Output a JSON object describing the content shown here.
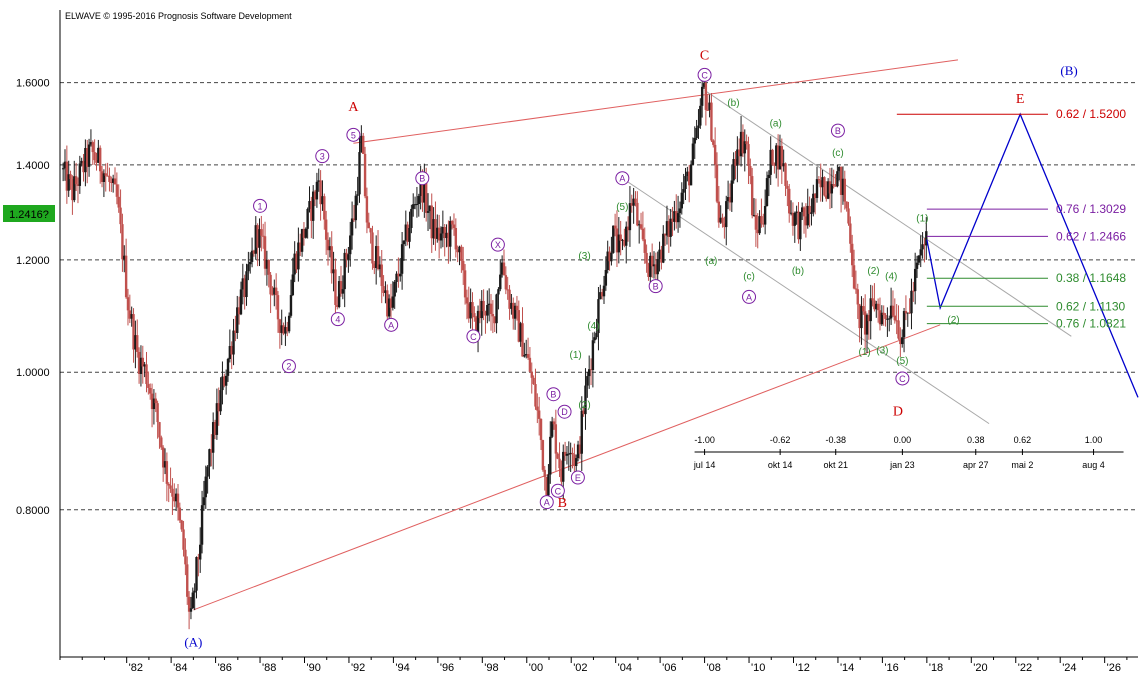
{
  "header": {
    "copyright": "ELWAVE © 1995-2016 Prognosis Software Development"
  },
  "current_price_label": "1.2416?",
  "colors": {
    "candle_up": "#1a1a1a",
    "candle_down": "#c0504d",
    "channel_red": "#e06060",
    "channel_gray": "#a8a8a8",
    "projection_blue": "#0000cc",
    "purple": "#7b1fa2",
    "green": "#2e8b2e",
    "red_label": "#cc0000",
    "blue_label": "#0000cc",
    "badge_green": "#1fa81f"
  },
  "chart_data": {
    "type": "candlestick",
    "x_axis": {
      "range": [
        1979.0,
        2027.5
      ],
      "tick_years": [
        1982,
        1984,
        1986,
        1988,
        1990,
        1992,
        1994,
        1996,
        1998,
        2000,
        2002,
        2004,
        2006,
        2008,
        2010,
        2012,
        2014,
        2016,
        2018,
        2020,
        2022,
        2024,
        2026
      ],
      "tick_labels": [
        "'82",
        "'84",
        "'86",
        "'88",
        "'90",
        "'92",
        "'94",
        "'96",
        "'98",
        "'00",
        "'02",
        "'04",
        "'06",
        "'08",
        "'10",
        "'12",
        "'14",
        "'16",
        "'18",
        "'20",
        "'22",
        "'24",
        "'26"
      ]
    },
    "y_axis": {
      "scale": "log",
      "range": [
        0.63,
        1.8
      ],
      "ticks": [
        0.8,
        1.0,
        1.2,
        1.4,
        1.6
      ],
      "tick_labels": [
        "0.8000",
        "1.0000",
        "1.2000",
        "1.4000",
        "1.6000"
      ],
      "grid": "dashed"
    },
    "price_path": [
      [
        1979.1,
        1.39
      ],
      [
        1979.6,
        1.34
      ],
      [
        1980.4,
        1.43
      ],
      [
        1980.9,
        1.4
      ],
      [
        1981.6,
        1.32
      ],
      [
        1982.1,
        1.12
      ],
      [
        1982.5,
        1.03
      ],
      [
        1982.9,
        1.0
      ],
      [
        1983.4,
        0.93
      ],
      [
        1983.8,
        0.85
      ],
      [
        1984.2,
        0.82
      ],
      [
        1984.6,
        0.75
      ],
      [
        1984.9,
        0.66
      ],
      [
        1985.3,
        0.75
      ],
      [
        1985.7,
        0.86
      ],
      [
        1986.2,
        0.95
      ],
      [
        1986.7,
        1.04
      ],
      [
        1987.1,
        1.12
      ],
      [
        1987.5,
        1.16
      ],
      [
        1987.9,
        1.26
      ],
      [
        1988.3,
        1.2
      ],
      [
        1988.8,
        1.1
      ],
      [
        1989.2,
        1.07
      ],
      [
        1989.6,
        1.2
      ],
      [
        1990.2,
        1.28
      ],
      [
        1990.7,
        1.37
      ],
      [
        1991.1,
        1.22
      ],
      [
        1991.5,
        1.12
      ],
      [
        1991.9,
        1.2
      ],
      [
        1992.3,
        1.3
      ],
      [
        1992.6,
        1.45
      ],
      [
        1992.9,
        1.25
      ],
      [
        1993.4,
        1.18
      ],
      [
        1993.9,
        1.1
      ],
      [
        1994.4,
        1.2
      ],
      [
        1994.9,
        1.3
      ],
      [
        1995.3,
        1.36
      ],
      [
        1995.8,
        1.26
      ],
      [
        1996.3,
        1.24
      ],
      [
        1996.8,
        1.26
      ],
      [
        1997.2,
        1.15
      ],
      [
        1997.7,
        1.07
      ],
      [
        1998.1,
        1.12
      ],
      [
        1998.5,
        1.08
      ],
      [
        1998.9,
        1.2
      ],
      [
        1999.3,
        1.12
      ],
      [
        1999.7,
        1.07
      ],
      [
        2000.2,
        1.0
      ],
      [
        2000.6,
        0.92
      ],
      [
        2000.9,
        0.83
      ],
      [
        2001.2,
        0.92
      ],
      [
        2001.6,
        0.85
      ],
      [
        2001.9,
        0.9
      ],
      [
        2002.3,
        0.86
      ],
      [
        2002.7,
        0.97
      ],
      [
        2003.1,
        1.07
      ],
      [
        2003.5,
        1.17
      ],
      [
        2003.9,
        1.25
      ],
      [
        2004.3,
        1.21
      ],
      [
        2004.8,
        1.33
      ],
      [
        2005.2,
        1.23
      ],
      [
        2005.6,
        1.18
      ],
      [
        2006.0,
        1.21
      ],
      [
        2006.5,
        1.27
      ],
      [
        2006.9,
        1.32
      ],
      [
        2007.3,
        1.37
      ],
      [
        2007.7,
        1.46
      ],
      [
        2008.0,
        1.59
      ],
      [
        2008.4,
        1.48
      ],
      [
        2008.7,
        1.26
      ],
      [
        2009.1,
        1.3
      ],
      [
        2009.5,
        1.45
      ],
      [
        2009.9,
        1.46
      ],
      [
        2010.3,
        1.25
      ],
      [
        2010.7,
        1.3
      ],
      [
        2011.1,
        1.43
      ],
      [
        2011.5,
        1.42
      ],
      [
        2011.9,
        1.3
      ],
      [
        2012.3,
        1.27
      ],
      [
        2012.7,
        1.29
      ],
      [
        2013.1,
        1.34
      ],
      [
        2013.6,
        1.36
      ],
      [
        2013.9,
        1.39
      ],
      [
        2014.3,
        1.34
      ],
      [
        2014.6,
        1.25
      ],
      [
        2014.9,
        1.1
      ],
      [
        2015.3,
        1.08
      ],
      [
        2015.7,
        1.12
      ],
      [
        2016.1,
        1.09
      ],
      [
        2016.5,
        1.12
      ],
      [
        2016.9,
        1.06
      ],
      [
        2017.3,
        1.12
      ],
      [
        2017.7,
        1.2
      ],
      [
        2018.0,
        1.24
      ]
    ],
    "projection_path": [
      [
        2018.0,
        1.24
      ],
      [
        2018.6,
        1.11
      ],
      [
        2022.2,
        1.52
      ],
      [
        2027.5,
        0.96
      ]
    ],
    "channel_lines": [
      {
        "color": "red",
        "points": [
          [
            1985.0,
            0.68
          ],
          [
            2018.6,
            1.08
          ]
        ]
      },
      {
        "color": "red",
        "points": [
          [
            1992.2,
            1.45
          ],
          [
            2019.4,
            1.66
          ]
        ]
      },
      {
        "color": "gray",
        "points": [
          [
            2008.0,
            1.58
          ],
          [
            2024.5,
            1.06
          ]
        ]
      },
      {
        "color": "gray",
        "points": [
          [
            2004.3,
            1.37
          ],
          [
            2020.8,
            0.92
          ]
        ]
      }
    ],
    "fib_levels": [
      {
        "label": "0.62 / 1.5200",
        "ratio": 0.62,
        "value": 1.52,
        "color": "#cc0000"
      },
      {
        "label": "0.76 / 1.3029",
        "ratio": 0.76,
        "value": 1.3029,
        "color": "#7b1fa2"
      },
      {
        "label": "0.62 / 1.2466",
        "ratio": 0.62,
        "value": 1.2466,
        "color": "#7b1fa2"
      },
      {
        "label": "0.38 / 1.1648",
        "ratio": 0.38,
        "value": 1.1648,
        "color": "#2e8b2e"
      },
      {
        "label": "0.62 / 1.1130",
        "ratio": 0.62,
        "value": 1.113,
        "color": "#2e8b2e"
      },
      {
        "label": "0.76 / 1.0821",
        "ratio": 0.76,
        "value": 1.0821,
        "color": "#2e8b2e"
      }
    ],
    "time_ruler": {
      "ratios": [
        "-1.00",
        "-0.62",
        "-0.38",
        "0.00",
        "0.38",
        "0.62",
        "1.00"
      ],
      "dates": [
        {
          "label": "jul 14",
          "year": 2008.0
        },
        {
          "label": "okt 14",
          "year": 2011.4
        },
        {
          "label": "okt 21",
          "year": 2013.9
        },
        {
          "label": "jan 23",
          "year": 2016.9
        },
        {
          "label": "apr 27",
          "year": 2020.2
        },
        {
          "label": "mai 2",
          "year": 2022.3
        },
        {
          "label": "aug 4",
          "year": 2025.5
        }
      ],
      "ratio_years": [
        2008.0,
        2011.4,
        2013.9,
        2016.9,
        2020.2,
        2022.3,
        2025.5
      ]
    },
    "wave_labels": [
      {
        "text": "(A)",
        "x": 1985.0,
        "y": 0.645,
        "color": "blue",
        "style": "paren"
      },
      {
        "text": "A",
        "x": 1992.2,
        "y": 1.54,
        "color": "red",
        "style": "plain"
      },
      {
        "text": "B",
        "x": 2001.6,
        "y": 0.81,
        "color": "red",
        "style": "plain"
      },
      {
        "text": "C",
        "x": 2008.0,
        "y": 1.675,
        "color": "red",
        "style": "plain"
      },
      {
        "text": "D",
        "x": 2016.7,
        "y": 0.94,
        "color": "red",
        "style": "plain"
      },
      {
        "text": "E",
        "x": 2022.2,
        "y": 1.56,
        "color": "red",
        "style": "plain"
      },
      {
        "text": "(B)",
        "x": 2024.4,
        "y": 1.63,
        "color": "blue",
        "style": "paren"
      },
      {
        "text": "1",
        "x": 1988.0,
        "y": 1.31,
        "color": "purple",
        "style": "circle"
      },
      {
        "text": "2",
        "x": 1989.3,
        "y": 1.01,
        "color": "purple",
        "style": "circle"
      },
      {
        "text": "3",
        "x": 1990.8,
        "y": 1.42,
        "color": "purple",
        "style": "circle"
      },
      {
        "text": "4",
        "x": 1991.5,
        "y": 1.09,
        "color": "purple",
        "style": "circle"
      },
      {
        "text": "5",
        "x": 1992.2,
        "y": 1.47,
        "color": "purple",
        "style": "circle"
      },
      {
        "text": "A",
        "x": 1993.9,
        "y": 1.08,
        "color": "purple",
        "style": "circle"
      },
      {
        "text": "B",
        "x": 1995.3,
        "y": 1.37,
        "color": "purple",
        "style": "circle"
      },
      {
        "text": "C",
        "x": 1997.6,
        "y": 1.06,
        "color": "purple",
        "style": "circle"
      },
      {
        "text": "X",
        "x": 1998.7,
        "y": 1.23,
        "color": "purple",
        "style": "circle"
      },
      {
        "text": "A",
        "x": 2000.9,
        "y": 0.81,
        "color": "purple",
        "style": "circle"
      },
      {
        "text": "B",
        "x": 2001.2,
        "y": 0.965,
        "color": "purple",
        "style": "circle"
      },
      {
        "text": "C",
        "x": 2001.4,
        "y": 0.825,
        "color": "purple",
        "style": "circle"
      },
      {
        "text": "D",
        "x": 2001.7,
        "y": 0.938,
        "color": "purple",
        "style": "circle"
      },
      {
        "text": "E",
        "x": 2002.3,
        "y": 0.843,
        "color": "purple",
        "style": "circle"
      },
      {
        "text": "A",
        "x": 2004.3,
        "y": 1.37,
        "color": "purple",
        "style": "circle"
      },
      {
        "text": "B",
        "x": 2005.8,
        "y": 1.15,
        "color": "purple",
        "style": "circle"
      },
      {
        "text": "C",
        "x": 2008.0,
        "y": 1.62,
        "color": "purple",
        "style": "circle"
      },
      {
        "text": "A",
        "x": 2010.0,
        "y": 1.13,
        "color": "purple",
        "style": "circle"
      },
      {
        "text": "B",
        "x": 2014.0,
        "y": 1.48,
        "color": "purple",
        "style": "circle"
      },
      {
        "text": "C",
        "x": 2016.9,
        "y": 0.99,
        "color": "purple",
        "style": "circle"
      },
      {
        "text": "3",
        "x": 2002.6,
        "y": 1.21,
        "color": "green",
        "style": "paren"
      },
      {
        "text": "4",
        "x": 2003.0,
        "y": 1.08,
        "color": "green",
        "style": "paren"
      },
      {
        "text": "5",
        "x": 2004.3,
        "y": 1.31,
        "color": "green",
        "style": "paren"
      },
      {
        "text": "1",
        "x": 2002.2,
        "y": 1.03,
        "color": "green",
        "style": "paren"
      },
      {
        "text": "2",
        "x": 2002.6,
        "y": 0.95,
        "color": "green",
        "style": "paren"
      },
      {
        "text": "a",
        "x": 2008.3,
        "y": 1.2,
        "color": "green",
        "style": "paren"
      },
      {
        "text": "b",
        "x": 2009.3,
        "y": 1.55,
        "color": "green",
        "style": "paren"
      },
      {
        "text": "c",
        "x": 2010.0,
        "y": 1.17,
        "color": "green",
        "style": "paren"
      },
      {
        "text": "a",
        "x": 2011.2,
        "y": 1.5,
        "color": "green",
        "style": "paren"
      },
      {
        "text": "b",
        "x": 2012.2,
        "y": 1.18,
        "color": "green",
        "style": "paren"
      },
      {
        "text": "c",
        "x": 2014.0,
        "y": 1.43,
        "color": "green",
        "style": "paren"
      },
      {
        "text": "1",
        "x": 2015.2,
        "y": 1.035,
        "color": "green",
        "style": "paren"
      },
      {
        "text": "2",
        "x": 2015.6,
        "y": 1.18,
        "color": "green",
        "style": "paren"
      },
      {
        "text": "3",
        "x": 2016.0,
        "y": 1.038,
        "color": "green",
        "style": "paren"
      },
      {
        "text": "4",
        "x": 2016.4,
        "y": 1.17,
        "color": "green",
        "style": "paren"
      },
      {
        "text": "5",
        "x": 2016.9,
        "y": 1.02,
        "color": "green",
        "style": "paren"
      },
      {
        "text": "1",
        "x": 2017.8,
        "y": 1.285,
        "color": "green",
        "style": "paren"
      },
      {
        "text": "2",
        "x": 2019.2,
        "y": 1.09,
        "color": "green",
        "style": "paren"
      }
    ]
  }
}
